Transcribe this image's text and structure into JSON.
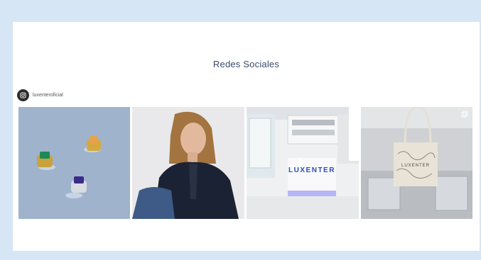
{
  "section": {
    "title": "Redes Sociales"
  },
  "profile": {
    "handle": "luxenteroficial",
    "icon": "instagram-icon"
  },
  "posts": [
    {
      "name": "rings-post"
    },
    {
      "name": "model-post"
    },
    {
      "name": "store-video-post",
      "sign_text": "LUXENTER",
      "overlay_icon": "play-icon"
    },
    {
      "name": "tote-bag-post",
      "bag_text": "LUXENTER",
      "overlay_icon": "carousel-icon"
    }
  ]
}
